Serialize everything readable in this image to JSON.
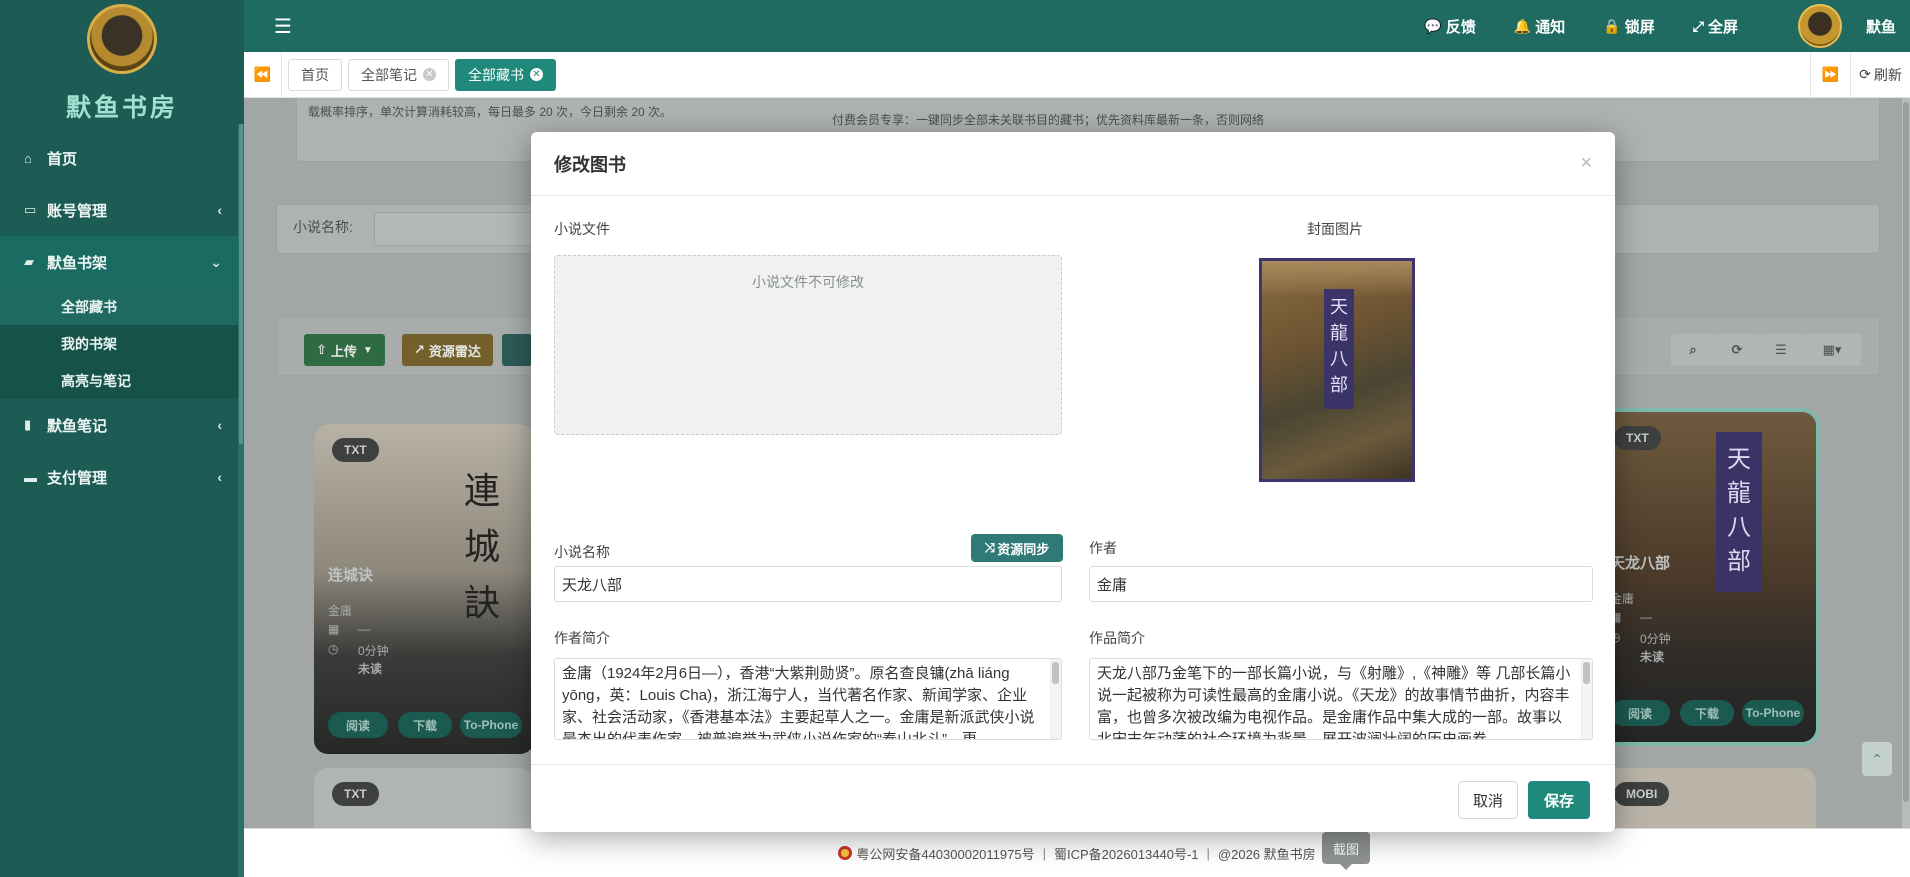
{
  "sidebar": {
    "logo_text": "默鱼书房",
    "items": [
      {
        "label": "首页",
        "icon": "home-icon"
      },
      {
        "label": "账号管理",
        "icon": "id-card-icon"
      },
      {
        "label": "默鱼书架",
        "icon": "folder-open-icon"
      },
      {
        "label": "默鱼笔记",
        "icon": "book-icon"
      },
      {
        "label": "支付管理",
        "icon": "credit-card-icon"
      }
    ],
    "subitems": [
      "全部藏书",
      "我的书架",
      "高亮与笔记"
    ]
  },
  "topbar": {
    "feedback": "反馈",
    "notify": "通知",
    "lock": "锁屏",
    "fullscreen": "全屏",
    "user": "默鱼"
  },
  "tabs": {
    "items": [
      "首页",
      "全部笔记",
      "全部藏书"
    ],
    "refresh": "刷新"
  },
  "background": {
    "notice_left": "载概率排序，单次计算消耗较高，每日最多 20 次，今日剩余 20 次。",
    "notice_right": "付费会员专享：一键同步全部未关联书目的藏书；优先资料库最新一条，否则网络",
    "search_label": "小说名称:",
    "upload": "上传",
    "radar": "资源雷达",
    "cards": [
      {
        "badge": "TXT",
        "title": "连城诀",
        "author": "金庸",
        "date": "—",
        "duration": "0分钟",
        "status": "未读",
        "read": "阅读",
        "download": "下载",
        "phone": "To-Phone"
      },
      {
        "badge": "TXT",
        "title": "天龙八部",
        "author": "金庸",
        "date": "—",
        "duration": "0分钟",
        "status": "未读",
        "read": "阅读",
        "download": "下载",
        "phone": "To-Phone"
      }
    ],
    "badge_bottom_left": "TXT",
    "badge_bottom_right": "MOBI"
  },
  "modal": {
    "title": "修改图书",
    "file_label": "小说文件",
    "file_placeholder": "小说文件不可修改",
    "cover_label": "封面图片",
    "name_label": "小说名称",
    "sync_button": "资源同步",
    "name_value": "天龙八部",
    "author_label": "作者",
    "author_value": "金庸",
    "author_intro_label": "作者简介",
    "author_intro": "金庸（1924年2月6日—），香港“大紫荆勋贤”。原名查良镛(zhā liáng yōng，英：Louis Cha)，浙江海宁人，当代著名作家、新闻学家、企业家、社会活动家，《香港基本法》主要起草人之一。金庸是新派武侠小说最杰出的代表作家，被普遍誉为武侠小说作家的“泰山北斗”，更",
    "work_intro_label": "作品简介",
    "work_intro": "天龙八部乃金笔下的一部长篇小说，与《射雕》,《神雕》等 几部长篇小说一起被称为可读性最高的金庸小说。《天龙》的故事情节曲折，内容丰富，也曾多次被改编为电视作品。是金庸作品中集大成的一部。故事以北宋末年动荡的社会环境为背景，展开波澜壮阔的历史画卷，",
    "cancel": "取消",
    "save": "保存"
  },
  "footer": {
    "police": "粤公网安备44030002011975号",
    "icp": "蜀ICP备2026013440号-1",
    "copyright": "@2026 默鱼书房"
  },
  "tooltip": "截图",
  "colors": {
    "sidebar_bg": "#1c5c55",
    "topbar_bg": "#1f6b62",
    "accent": "#1f8a7b"
  }
}
